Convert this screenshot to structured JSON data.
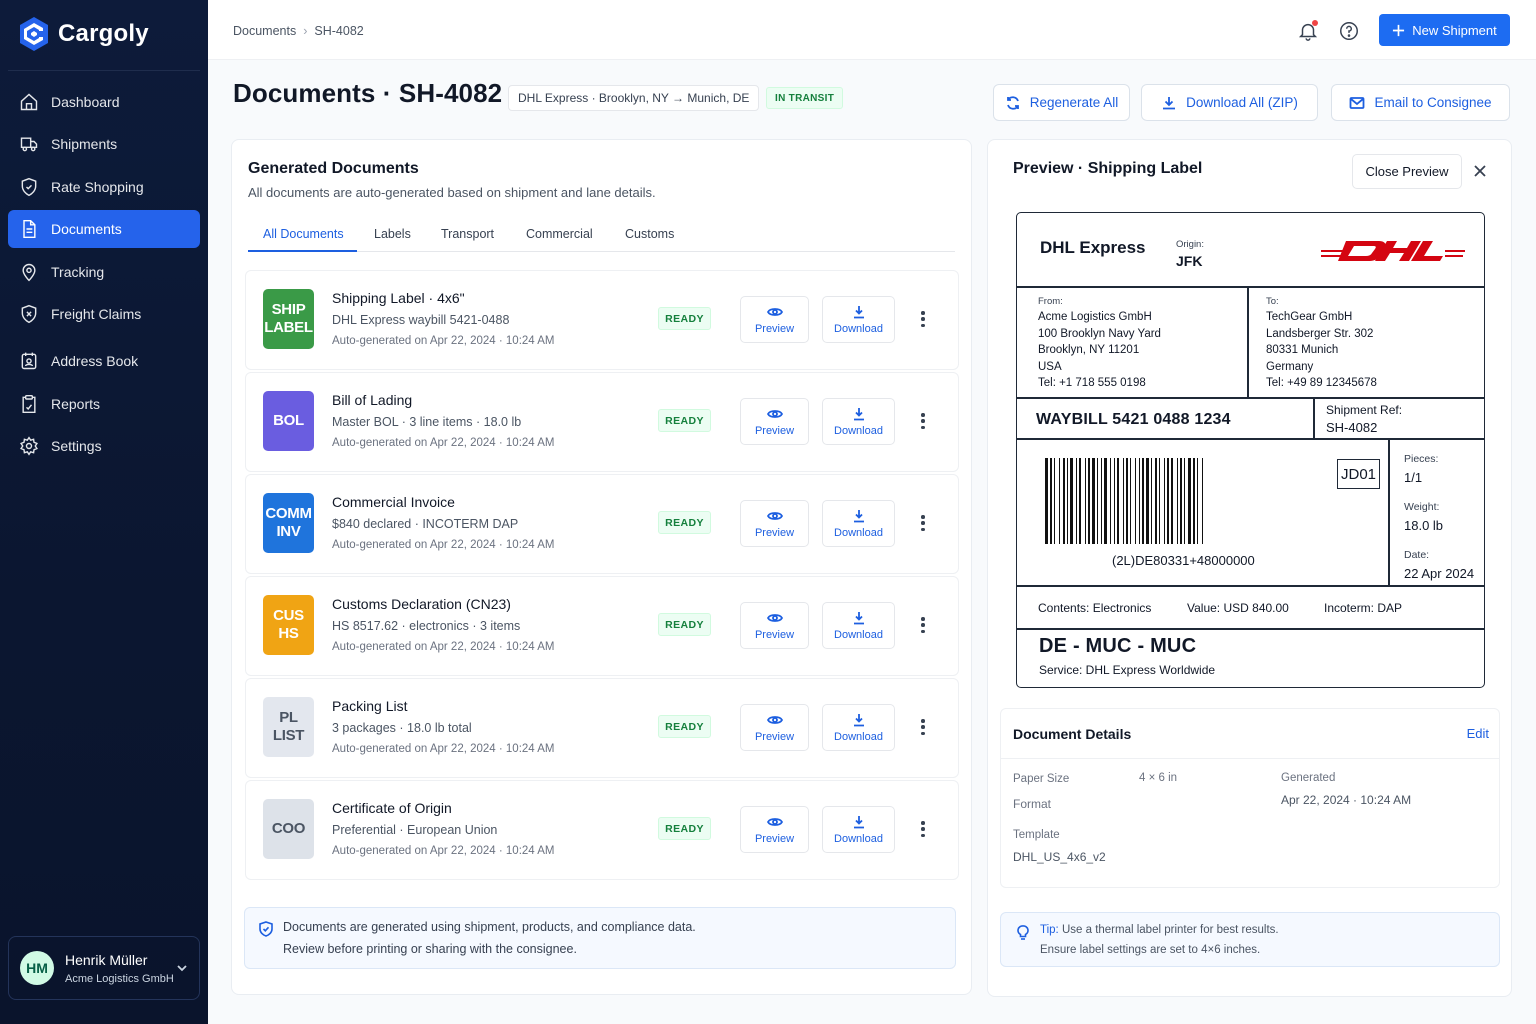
{
  "app": {
    "name": "Cargoly"
  },
  "sidebar": {
    "items": [
      {
        "label": "Dashboard",
        "icon": "home-icon"
      },
      {
        "label": "Shipments",
        "icon": "truck-icon"
      },
      {
        "label": "Rate Shopping",
        "icon": "tag-shield-icon"
      },
      {
        "label": "Documents",
        "icon": "document-icon",
        "active": true
      },
      {
        "label": "Tracking",
        "icon": "map-pin-icon"
      },
      {
        "label": "Freight Claims",
        "icon": "shield-x-icon"
      },
      {
        "label": "Address Book",
        "icon": "contact-book-icon"
      },
      {
        "label": "Reports",
        "icon": "clipboard-icon"
      },
      {
        "label": "Settings",
        "icon": "gear-icon"
      }
    ],
    "user": {
      "initials": "HM",
      "name": "Henrik Müller",
      "org": "Acme Logistics GmbH"
    }
  },
  "topbar": {
    "breadcrumb": [
      "Documents",
      "SH-4082"
    ],
    "new_shipment_label": "New Shipment"
  },
  "header": {
    "title": "Documents · SH-4082",
    "route": "DHL Express · Brooklyn, NY → Munich, DE",
    "status": "IN TRANSIT",
    "regenerate_label": "Regenerate All",
    "download_all_label": "Download All (ZIP)",
    "email_label": "Email to Consignee"
  },
  "generated": {
    "title": "Generated Documents",
    "subtitle": "All documents are auto-generated based on shipment and lane details.",
    "tabs": [
      "All Documents",
      "Labels",
      "Transport",
      "Commercial",
      "Customs"
    ],
    "active_tab": "All Documents",
    "preview_label": "Preview",
    "download_label": "Download",
    "docs": [
      {
        "badge": "SHIP\nLABEL",
        "color": "#3a9a47",
        "badge_text_color": "#ffffff",
        "title": "Shipping Label · 4x6\"",
        "meta": "DHL Express waybill 5421-0488",
        "generated": "Auto-generated on Apr 22, 2024 · 10:24 AM",
        "status": "READY"
      },
      {
        "badge": "BOL",
        "color": "#6a5de0",
        "badge_text_color": "#ffffff",
        "title": "Bill of Lading",
        "meta": "Master BOL · 3 line items · 18.0 lb",
        "generated": "Auto-generated on Apr 22, 2024 · 10:24 AM",
        "status": "READY"
      },
      {
        "badge": "COMM\nINV",
        "color": "#1f74dc",
        "badge_text_color": "#ffffff",
        "title": "Commercial Invoice",
        "meta": "$840 declared · INCOTERM DAP",
        "generated": "Auto-generated on Apr 22, 2024 · 10:24 AM",
        "status": "READY"
      },
      {
        "badge": "CUS\nHS",
        "color": "#f0a414",
        "badge_text_color": "#ffffff",
        "title": "Customs Declaration (CN23)",
        "meta": "HS 8517.62 · electronics · 3 items",
        "generated": "Auto-generated on Apr 22, 2024 · 10:24 AM",
        "status": "READY"
      },
      {
        "badge": "PL\nLIST",
        "color": "#e3e7ee",
        "badge_text_color": "#4b5563",
        "title": "Packing List",
        "meta": "3 packages · 18.0 lb total",
        "generated": "Auto-generated on Apr 22, 2024 · 10:24 AM",
        "status": "READY"
      },
      {
        "badge": "COO",
        "color": "#dde2e9",
        "badge_text_color": "#4b5563",
        "title": "Certificate of Origin",
        "meta": "Preferential · European Union",
        "generated": "Auto-generated on Apr 22, 2024 · 10:24 AM",
        "status": "READY"
      }
    ],
    "note_line1": "Documents are generated using shipment, products, and compliance data.",
    "note_line2": "Review before printing or sharing with the consignee."
  },
  "preview": {
    "title": "Preview · Shipping Label",
    "close_label": "Close Preview",
    "label": {
      "carrier": "DHL Express",
      "origin_label": "Origin:",
      "origin": "JFK",
      "from_label": "From:",
      "from_lines": [
        "Acme Logistics GmbH",
        "100 Brooklyn Navy Yard",
        "Brooklyn, NY 11201",
        "USA",
        "Tel: +1 718 555 0198"
      ],
      "to_label": "To:",
      "to_lines": [
        "TechGear GmbH",
        "Landsberger Str. 302",
        "80331 Munich",
        "Germany",
        "Tel: +49 89 12345678"
      ],
      "waybill": "WAYBILL 5421 0488 1234",
      "ref_label": "Shipment Ref:",
      "ref": "SH-4082",
      "barcode_text": "(2L)DE80331+48000000",
      "code": "JD01",
      "pieces_label": "Pieces:",
      "pieces": "1/1",
      "weight_label": "Weight:",
      "weight": "18.0 lb",
      "date_label": "Date:",
      "date": "22 Apr 2024",
      "contents": "Contents: Electronics",
      "value": "Value: USD 840.00",
      "incoterm": "Incoterm: DAP",
      "route": "DE - MUC - MUC",
      "service": "Service: DHL Express Worldwide"
    },
    "details": {
      "title": "Document Details",
      "edit_label": "Edit",
      "paper_size_label": "Paper Size",
      "paper_size": "4 × 6 in",
      "format_label": "Format",
      "generated_label": "Generated",
      "generated": "Apr 22, 2024 · 10:24 AM",
      "template_label": "Template",
      "template": "DHL_US_4x6_v2"
    },
    "tip": {
      "prefix": "Tip:",
      "line1": "Use a thermal label printer for best results.",
      "line2": "Ensure label settings are set to 4×6 inches."
    }
  },
  "colors": {
    "accent": "#1d6cf2",
    "sidebar": "#0d1b3a",
    "ready": "#15803d",
    "dhl_yellow": "#ffcc00",
    "dhl_red": "#d40511"
  }
}
